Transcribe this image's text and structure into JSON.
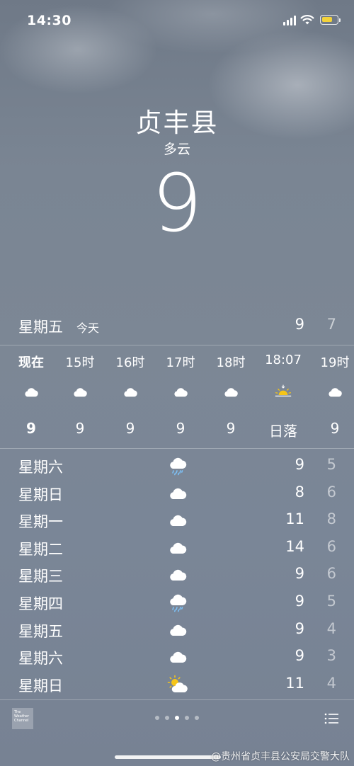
{
  "status": {
    "time": "14:30",
    "battery_color": "#f3d23a",
    "battery_level": 0.75
  },
  "location": {
    "city": "贞丰县",
    "condition": "多云",
    "temperature": "9"
  },
  "today": {
    "day": "星期五",
    "label": "今天",
    "high": "9",
    "low": "7"
  },
  "hourly": [
    {
      "time": "现在",
      "icon": "cloud-icon",
      "value": "9"
    },
    {
      "time": "15时",
      "icon": "cloud-icon",
      "value": "9"
    },
    {
      "time": "16时",
      "icon": "cloud-icon",
      "value": "9"
    },
    {
      "time": "17时",
      "icon": "cloud-icon",
      "value": "9"
    },
    {
      "time": "18时",
      "icon": "cloud-icon",
      "value": "9"
    },
    {
      "time": "18:07",
      "icon": "sunset-icon",
      "value": "日落"
    },
    {
      "time": "19时",
      "icon": "cloud-icon",
      "value": "9"
    }
  ],
  "daily": [
    {
      "day": "星期六",
      "icon": "rain-cloud-icon",
      "high": "9",
      "low": "5"
    },
    {
      "day": "星期日",
      "icon": "cloud-icon",
      "high": "8",
      "low": "6"
    },
    {
      "day": "星期一",
      "icon": "cloud-icon",
      "high": "11",
      "low": "8"
    },
    {
      "day": "星期二",
      "icon": "cloud-icon",
      "high": "14",
      "low": "6"
    },
    {
      "day": "星期三",
      "icon": "cloud-icon",
      "high": "9",
      "low": "6"
    },
    {
      "day": "星期四",
      "icon": "rain-cloud-icon",
      "high": "9",
      "low": "5"
    },
    {
      "day": "星期五",
      "icon": "cloud-icon",
      "high": "9",
      "low": "4"
    },
    {
      "day": "星期六",
      "icon": "cloud-icon",
      "high": "9",
      "low": "3"
    },
    {
      "day": "星期日",
      "icon": "partly-sunny-icon",
      "high": "11",
      "low": "4"
    }
  ],
  "footer": {
    "logo_text": "The Weather Channel",
    "page_count": 5,
    "active_page": 3,
    "watermark": "@贵州省贞丰县公安局交警大队"
  }
}
